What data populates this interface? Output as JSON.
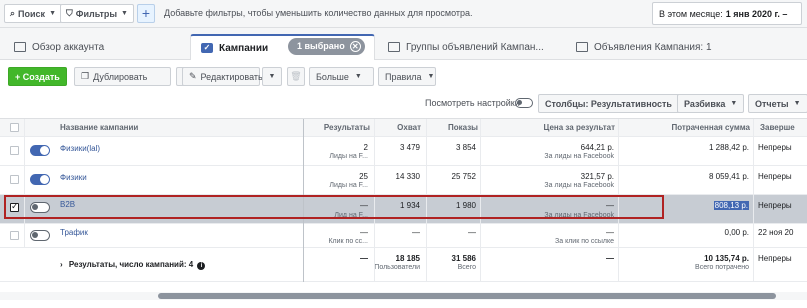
{
  "filterbar": {
    "search_label": "Поиск",
    "filters_label": "Фильтры",
    "plus": "+",
    "hint": "Добавьте фильтры, чтобы уменьшить количество данных для просмотра.",
    "date_prefix": "В этом месяце:",
    "date_value": "1 янв 2020 г. –"
  },
  "tabs": {
    "overview": "Обзор аккаунта",
    "campaigns": "Кампании",
    "selected": "1 выбрано",
    "adsets": "Группы объявлений Кампан...",
    "ads": "Объявления Кампания: 1"
  },
  "toolbar": {
    "create": "+ Создать",
    "duplicate": "Дублировать",
    "edit": "Редактировать",
    "more": "Больше",
    "rules": "Правила"
  },
  "settings": {
    "view_settings": "Посмотреть настройки",
    "columns": "Столбцы: Результативность",
    "breakdown": "Разбивка",
    "reports": "Отчеты"
  },
  "table": {
    "headers": {
      "name": "Название кампании",
      "results": "Результаты",
      "reach": "Охват",
      "impressions": "Показы",
      "cost_per_result": "Цена за результат",
      "spent": "Потраченная сумма",
      "end": "Заверше"
    },
    "rows": [
      {
        "name": "Физики(lal)",
        "results": "2",
        "results_sub": "Лиды на F...",
        "reach": "3 479",
        "impressions": "3 854",
        "cpr": "644,21 р.",
        "cpr_sub": "За лиды на Facebook",
        "spent": "1 288,42 р.",
        "end": "Непреры"
      },
      {
        "name": "Физики",
        "results": "25",
        "results_sub": "Лиды на F...",
        "reach": "14 330",
        "impressions": "25 752",
        "cpr": "321,57 р.",
        "cpr_sub": "За лиды на Facebook",
        "spent": "8 059,41 р.",
        "end": "Непреры"
      },
      {
        "name": "B2B",
        "results": "—",
        "results_sub": "Лид на F...",
        "reach": "1 934",
        "impressions": "1 980",
        "cpr": "—",
        "cpr_sub": "За лиды на Facebook",
        "spent": "808,13 р.",
        "end": "Непреры"
      },
      {
        "name": "Трафик",
        "results": "—",
        "results_sub": "Клик по сс...",
        "reach": "—",
        "impressions": "—",
        "cpr": "—",
        "cpr_sub": "За клик по ссылке",
        "spent": "0,00 р.",
        "end": "22 ноя 20"
      }
    ],
    "summary": {
      "label": "Результаты, число кампаний: 4",
      "results": "—",
      "reach": "18 185",
      "reach_sub": "Пользователи",
      "impressions": "31 586",
      "impressions_sub": "Всего",
      "cpr": "—",
      "spent": "10 135,74 р.",
      "spent_sub": "Всего потрачено",
      "end": "Непреры"
    }
  }
}
